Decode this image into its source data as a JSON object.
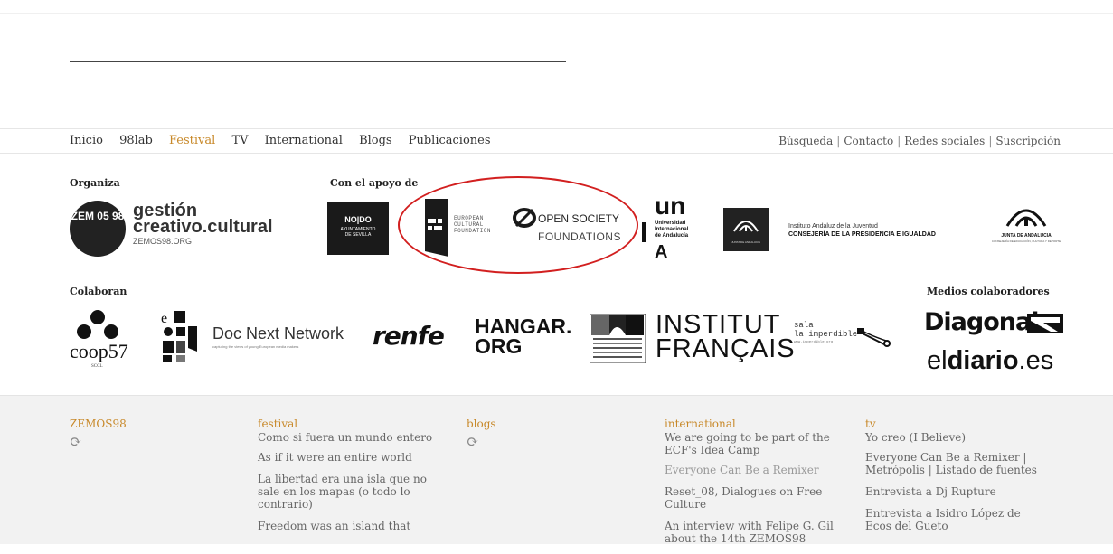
{
  "nav": {
    "items": [
      "Inicio",
      "98lab",
      "Festival",
      "TV",
      "International",
      "Blogs",
      "Publicaciones"
    ],
    "active": "Festival",
    "right_links": [
      "Búsqueda",
      "Contacto",
      "Redes sociales",
      "Suscripción"
    ],
    "separator": "|"
  },
  "sections": {
    "organiza": "Organiza",
    "apoyo": "Con el apoyo de",
    "colaboran": "Colaboran",
    "medios": "Medios colaboradores"
  },
  "logos": {
    "zemos": {
      "badge": "ZEM 05 98",
      "line1": "gestión",
      "line2": "creativo.cultural",
      "line3": "ZEMOS98.ORG"
    },
    "nodo": {
      "line1": "NO|DO",
      "line2": "AYUNTAMIENTO",
      "line3": "DE SEVILLA"
    },
    "ecf": {
      "line1": "EUROPEAN",
      "line2": "CULTURAL",
      "line3": "FOUNDATION"
    },
    "osf": {
      "line1": "OPEN SOCIETY",
      "line2": "FOUNDATIONS"
    },
    "unia": {
      "big": "un",
      "line1": "Universidad",
      "line2": "Internacional",
      "line3": "de Andalucía",
      "letter": "A"
    },
    "junta_small": "JUNTA DE ANDALUCIA",
    "instituto": {
      "line1": "Instituto Andaluz de la Juventud",
      "line2": "CONSEJERÍA DE LA PRESIDENCIA E IGUALDAD"
    },
    "junta": {
      "line1": "JUNTA DE ANDALUCIA",
      "line2": "CONSEJERÍA DE EDUCACIÓN, CULTURA Y DEPORTE"
    },
    "coop": {
      "text": "coop57",
      "sub": "SCCL"
    },
    "docnext": {
      "text": "Doc Next Network",
      "sub": "capturing the views of young European media makers"
    },
    "renfe": "renfe",
    "hangar": {
      "line1": "HANGAR.",
      "line2": "ORG"
    },
    "institut": {
      "line1": "INSTITUT",
      "line2": "FRANÇAIS"
    },
    "imperdible": {
      "line1": "sala",
      "line2": "la imperdible",
      "line3": "www.imperdible.org"
    },
    "diagonal": "Diagonal",
    "eldiario": {
      "a": "el",
      "b": "diario",
      "c": ".es"
    }
  },
  "footer": {
    "columns": [
      {
        "heading": "ZEMOS98",
        "items": []
      },
      {
        "heading": "festival",
        "items": [
          "Como si fuera un mundo entero",
          "As if it were an entire world",
          "La libertad era una isla que no sale en los mapas (o todo lo contrario)",
          "Freedom was an island that"
        ]
      },
      {
        "heading": "blogs",
        "items": []
      },
      {
        "heading": "international",
        "items": [
          "We are going to be part of the ECF's Idea Camp",
          "Everyone Can Be a Remixer",
          "Reset_08, Dialogues on Free Culture",
          "An interview with Felipe G. Gil about the 14th ZEMOS98"
        ]
      },
      {
        "heading": "tv",
        "items": [
          "Yo creo (I Believe)",
          "Everyone Can Be a Remixer | Metrópolis | Listado de fuentes",
          "Entrevista a Dj Rupture",
          "Entrevista a Isidro López de Ecos del Gueto"
        ]
      }
    ]
  },
  "colors": {
    "accent": "#c8892a",
    "ellipse": "#d21f1f"
  }
}
